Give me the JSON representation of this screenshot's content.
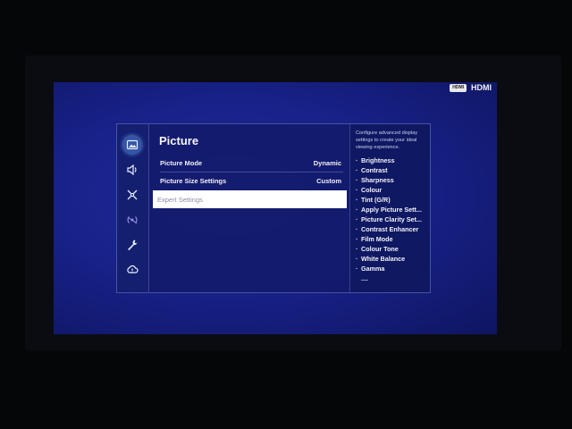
{
  "source": {
    "badge": "HDMI",
    "label": "HDMI"
  },
  "menu": {
    "icons": [
      "picture-icon",
      "sound-icon",
      "network-icon",
      "broadcasting-icon",
      "wrench-icon",
      "support-icon"
    ],
    "title": "Picture",
    "items": [
      {
        "label": "Picture Mode",
        "value": "Dynamic"
      },
      {
        "label": "Picture Size Settings",
        "value": "Custom"
      },
      {
        "label": "Expert Settings",
        "value": ""
      }
    ],
    "selected_index": 2
  },
  "help": {
    "description": "Configure advanced display settings to create your ideal viewing experience.",
    "items": [
      "Brightness",
      "Contrast",
      "Sharpness",
      "Colour",
      "Tint (G/R)",
      "Apply Picture Sett...",
      "Picture Clarity Set...",
      "Contrast Enhancer",
      "Film Mode",
      "Colour Tone",
      "White Balance",
      "Gamma",
      "...."
    ]
  }
}
